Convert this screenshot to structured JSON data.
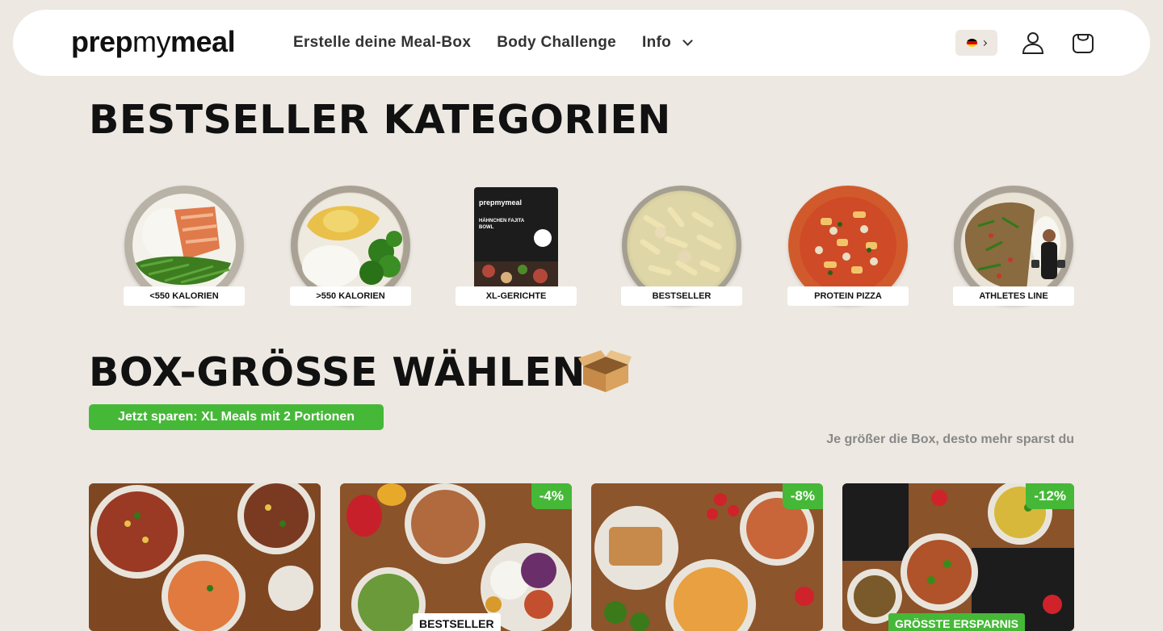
{
  "header": {
    "logo": {
      "part1": "prep",
      "part2": "my",
      "part3": "meal"
    },
    "nav": [
      {
        "label": "Erstelle deine Meal-Box"
      },
      {
        "label": "Body Challenge"
      },
      {
        "label": "Info"
      }
    ],
    "language_flag": "de-flag-icon"
  },
  "categories": {
    "title": "BESTSELLER KATEGORIEN",
    "items": [
      {
        "label": "<550 KALORIEN"
      },
      {
        "label": ">550 KALORIEN"
      },
      {
        "label": "XL-GERICHTE"
      },
      {
        "label": "BESTSELLER"
      },
      {
        "label": "PROTEIN PIZZA"
      },
      {
        "label": "ATHLETES LINE"
      }
    ],
    "pack": {
      "brand": "prepmymeal",
      "title": "HÄHNCHEN FAJITA BOWL"
    }
  },
  "box": {
    "title": "BOX-GRÖSSE WÄHLEN",
    "promo": "Jetzt sparen: XL Meals mit 2 Portionen",
    "subline": "Je größer die Box, desto mehr sparst du",
    "cards": [
      {
        "discount": "",
        "badge": ""
      },
      {
        "discount": "-4%",
        "badge": "BESTSELLER"
      },
      {
        "discount": "-8%",
        "badge": ""
      },
      {
        "discount": "-12%",
        "badge": "GRÖSSTE ERSPARNIS"
      }
    ]
  },
  "colors": {
    "accent_green": "#46b838",
    "background": "#ede8e2"
  }
}
